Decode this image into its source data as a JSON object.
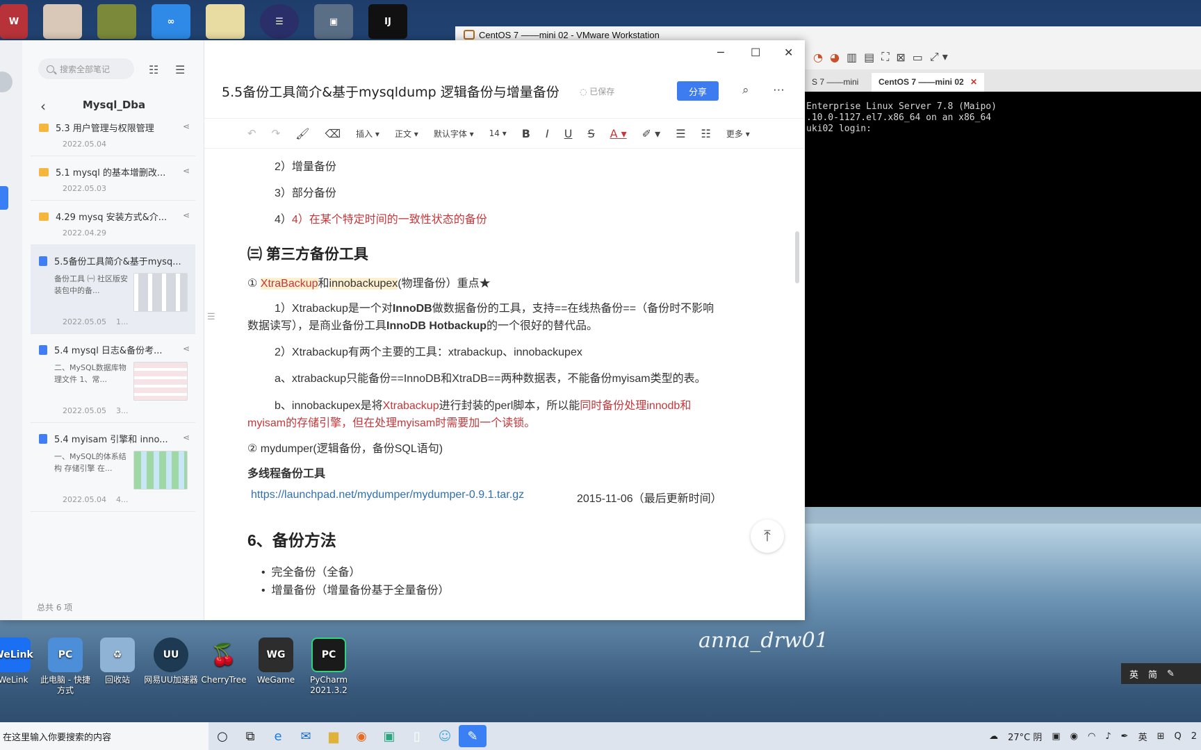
{
  "desktop": {
    "bottom_icons": [
      {
        "label": "WeLink",
        "short": "WeLink",
        "color": "#1a6ff2"
      },
      {
        "label": "此电脑 - 快捷方式",
        "short": "PC",
        "color": "#4c8ed8"
      },
      {
        "label": "回收站",
        "short": "♻",
        "color": "#8fb3d4"
      },
      {
        "label": "网易UU加速器",
        "short": "UU",
        "color": "#1d3a52"
      },
      {
        "label": "CherryTree",
        "short": "🍒",
        "color": "#00000000"
      },
      {
        "label": "WeGame",
        "short": "WG",
        "color": "#2d2d2d"
      },
      {
        "label": "PyCharm 2021.3.2",
        "short": "PC",
        "color": "#1a1a1a"
      }
    ],
    "watermark": "anna_drw01"
  },
  "vmware": {
    "title": "CentOS 7 ——mini 02 - VMware Workstation",
    "tabs": [
      "S 7 ——mini",
      "CentOS 7 ——mini 02"
    ],
    "console_lines": [
      "Enterprise Linux Server 7.8 (Maipo)",
      ".10.0-1127.el7.x86_64 on an x86_64",
      "",
      "uki02 login:"
    ],
    "ime": [
      "英",
      "简"
    ]
  },
  "sidebar": {
    "search_placeholder": "搜索全部笔记",
    "folder_title": "Mysql_Dba",
    "notes": [
      {
        "type": "folder",
        "title": "5.3 用户管理与权限管理",
        "date": "2022.05.04"
      },
      {
        "type": "folder",
        "title": "5.1 mysql 的基本增删改...",
        "date": "2022.05.03"
      },
      {
        "type": "folder",
        "title": "4.29 mysq 安装方式&介...",
        "date": "2022.04.29"
      },
      {
        "type": "doc",
        "title": "5.5备份工具简介&基于mysq...",
        "preview": "备份工具 ㈠ 社区版安装包中的备...",
        "date": "2022.05.05",
        "extra": "1...",
        "thumb": "flow"
      },
      {
        "type": "doc",
        "title": "5.4 mysql 日志&备份考...",
        "preview": "二、MySQL数据库物理文件 1、常...",
        "date": "2022.05.05",
        "extra": "3...",
        "thumb": "pink"
      },
      {
        "type": "doc",
        "title": "5.4 myisam 引擎和 inno...",
        "preview": "一、MySQL的体系结构 存储引擎 在...",
        "date": "2022.05.04",
        "extra": "4...",
        "thumb": "green"
      }
    ],
    "total": "总共 6 项"
  },
  "editor": {
    "title": "5.5备份工具简介&基于mysqldump 逻辑备份与增量备份",
    "saved": "已保存",
    "share": "分享",
    "toolbar": {
      "insert": "插入",
      "style": "正文",
      "font": "默认字体",
      "size": "14",
      "more": "更多"
    },
    "body": {
      "l1": "2）增量备份",
      "l2": "3）部分备份",
      "l3": "4）在某个特定时间的一致性状态的备份",
      "h_third": "㈢ 第三方备份工具",
      "xb_num": "① ",
      "xb_a": "XtraBackup",
      "xb_and": "和",
      "xb_b": "innobackupex",
      "xb_tail": "(物理备份）重点★",
      "p1_a": "1）Xtrabackup是一个对",
      "p1_b": "InnoDB",
      "p1_c": "做数据备份的工具，支持==在线热备份==（备份时不影响",
      "p1_d": "数据读写），是商业备份工具",
      "p1_e": "InnoDB Hotbackup",
      "p1_f": "的一个很好的替代品。",
      "p2": "2）Xtrabackup有两个主要的工具：xtrabackup、innobackupex",
      "pa": "a、xtrabackup只能备份==InnoDB和XtraDB==两种数据表，不能备份myisam类型的表。",
      "pb_a": "b、innobackupex是将",
      "pb_b": "Xtrabackup",
      "pb_c": "进行封装的perl脚本，所以能",
      "pb_d": "同时备份处理innodb和",
      "pb_e": "myisam的存储引擎，但在处理myisam时需要加一个读锁。",
      "md": "② mydumper(逻辑备份，备份SQL语句)",
      "md_sub": "多线程备份工具",
      "md_link": "https://launchpad.net/mydumper/mydumper-0.9.1.tar.gz",
      "md_date": "2015-11-06（最后更新时间）",
      "h_method": "6、备份方法",
      "bullet1": "完全备份（全备）",
      "bullet2": "增量备份（增量备份基于全量备份）"
    }
  },
  "taskbar": {
    "search": "在这里输入你要搜索的内容",
    "weather": "27°C 阴",
    "lang": "英",
    "clock": "2"
  },
  "colors": {
    "accent": "#3d7bf0",
    "red_text": "#c4373a",
    "link": "#2f6fb3"
  }
}
